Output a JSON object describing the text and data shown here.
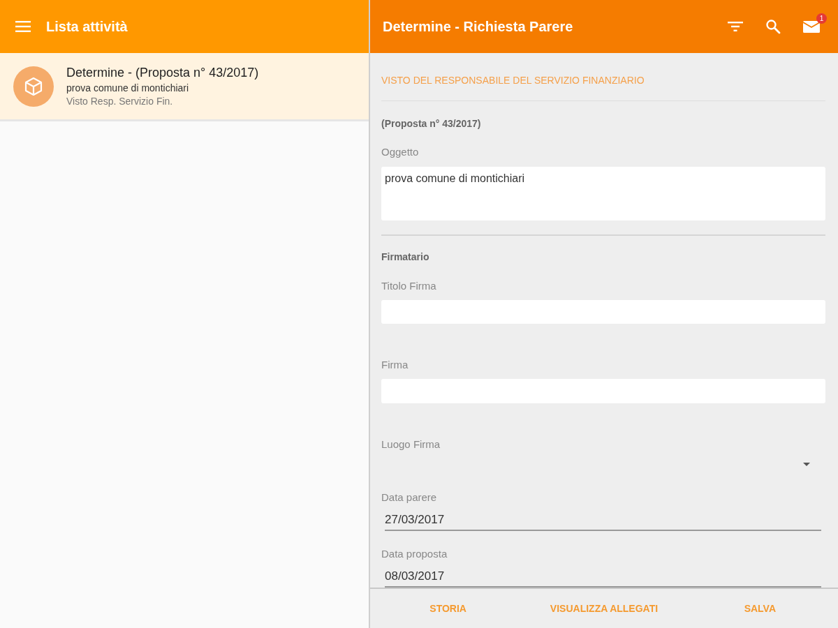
{
  "list_pane": {
    "title": "Lista attività",
    "items": [
      {
        "title": "Determine - (Proposta n° 43/2017)",
        "subtitle": "prova comune di montichiari",
        "status": "Visto Resp. Servizio Fin.",
        "selected": true
      }
    ]
  },
  "detail_pane": {
    "title": "Determine - Richiesta Parere",
    "notification_badge": "1",
    "section_title": "VISTO DEL RESPONSABILE DEL SERVIZIO FINANZIARIO",
    "reference": "(Proposta n° 43/2017)",
    "fields": [
      {
        "kind": "textarea",
        "label": "Oggetto",
        "value": "prova comune di montichiari"
      }
    ],
    "group_title": "Firmatario",
    "group_fields": [
      {
        "kind": "text",
        "label": "Titolo Firma"
      },
      {
        "kind": "text",
        "label": "Firma"
      },
      {
        "kind": "select",
        "label": "Luogo Firma"
      },
      {
        "kind": "date",
        "label": "Data parere",
        "value": "27/03/2017"
      },
      {
        "kind": "date",
        "label": "Data proposta",
        "value": "08/03/2017"
      }
    ],
    "actions": [
      "STORIA",
      "VISUALIZZA ALLEGATI",
      "SALVA"
    ]
  }
}
